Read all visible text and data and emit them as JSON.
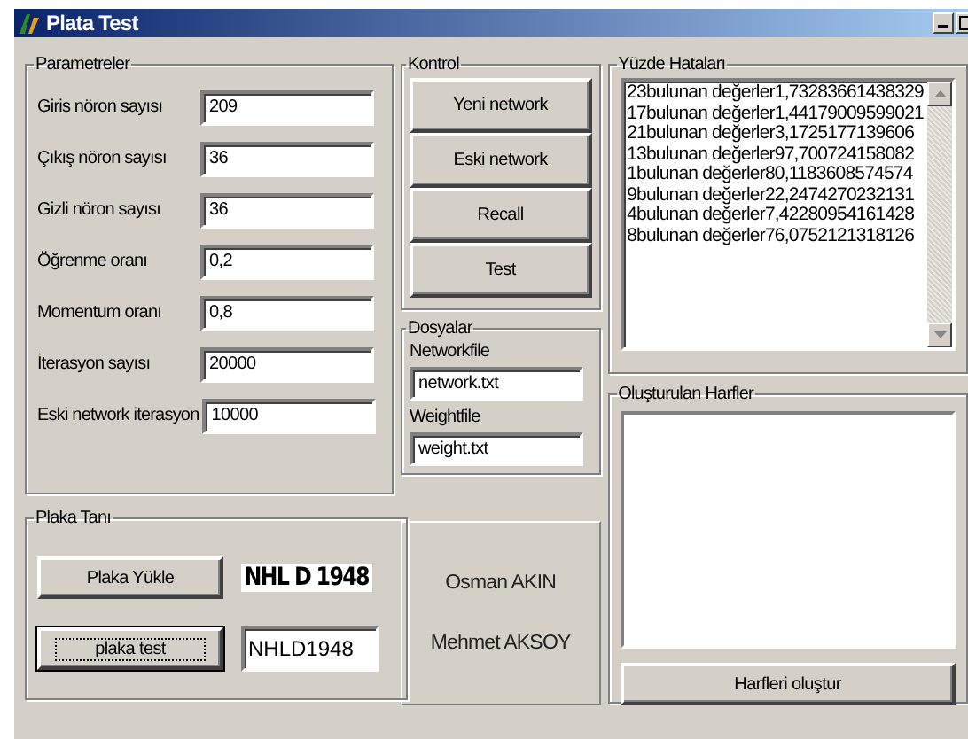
{
  "window": {
    "title": "Plata Test"
  },
  "parameters": {
    "title": "Parametreler",
    "fields": [
      {
        "label": "Giris nöron sayısı",
        "value": "209"
      },
      {
        "label": "Çıkış nöron sayısı",
        "value": "36"
      },
      {
        "label": "Gizli nöron sayısı",
        "value": "36"
      },
      {
        "label": "Öğrenme oranı",
        "value": "0,2"
      },
      {
        "label": "Momentum oranı",
        "value": "0,8"
      },
      {
        "label": "İterasyon sayısı",
        "value": "20000"
      },
      {
        "label": "Eski network iterasyon",
        "value": "10000"
      }
    ]
  },
  "kontrol": {
    "title": "Kontrol",
    "buttons": [
      "Yeni network",
      "Eski network",
      "Recall",
      "Test"
    ]
  },
  "dosyalar": {
    "title": "Dosyalar",
    "fields": [
      {
        "label": "Networkfile",
        "value": "network.txt"
      },
      {
        "label": "Weightfile",
        "value": "weight.txt"
      }
    ]
  },
  "yuzde_hatalari": {
    "title": "Yüzde Hataları",
    "lines": [
      "23bulunan değerler1,73283661438329",
      "17bulunan değerler1,44179009599021",
      "21bulunan değerler3,1725177139606",
      "13bulunan değerler97,700724158082",
      "1bulunan değerler80,1183608574574",
      "9bulunan değerler22,2474270232131",
      "4bulunan değerler7,42280954161428",
      "8bulunan değerler76,0752121318126"
    ]
  },
  "olusturulan_harfler": {
    "title": "Oluşturulan Harfler",
    "button": "Harfleri oluştur"
  },
  "plaka_tani": {
    "title": "Plaka Tanı",
    "load_button": "Plaka Yükle",
    "plate_image_text": "NHL D 1948",
    "test_button": "plaka test",
    "result": "NHLD1948"
  },
  "authors": [
    "Osman AKIN",
    "Mehmet AKSOY"
  ]
}
